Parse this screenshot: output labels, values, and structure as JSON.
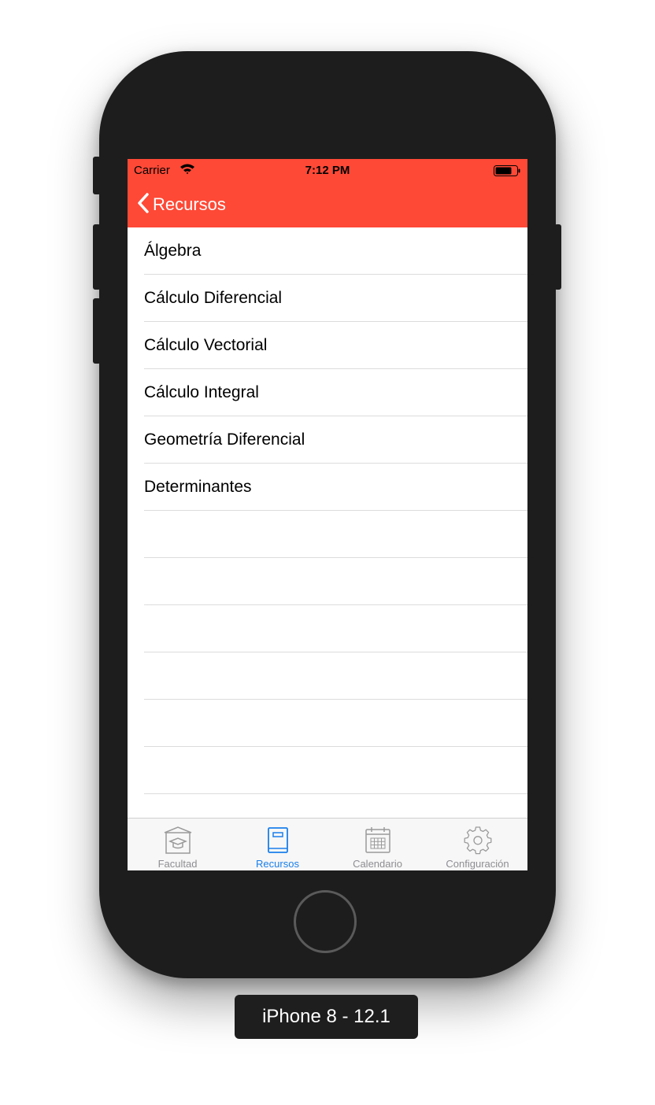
{
  "status_bar": {
    "carrier": "Carrier",
    "time": "7:12 PM"
  },
  "nav": {
    "back_label": "Recursos"
  },
  "list": {
    "items": [
      {
        "label": "Álgebra"
      },
      {
        "label": "Cálculo Diferencial"
      },
      {
        "label": "Cálculo Vectorial"
      },
      {
        "label": "Cálculo Integral"
      },
      {
        "label": "Geometría Diferencial"
      },
      {
        "label": "Determinantes"
      },
      {
        "label": ""
      },
      {
        "label": ""
      },
      {
        "label": ""
      },
      {
        "label": ""
      },
      {
        "label": ""
      },
      {
        "label": ""
      }
    ]
  },
  "tabs": [
    {
      "label": "Facultad",
      "icon": "graduation-building-icon",
      "active": false
    },
    {
      "label": "Recursos",
      "icon": "book-icon",
      "active": true
    },
    {
      "label": "Calendario",
      "icon": "calendar-icon",
      "active": false
    },
    {
      "label": "Configuración",
      "icon": "gear-icon",
      "active": false
    }
  ],
  "device_label": "iPhone 8 - 12.1",
  "colors": {
    "accent_bar": "#fe4936",
    "tab_active": "#1a7fec",
    "tab_inactive": "#8e8e93"
  }
}
